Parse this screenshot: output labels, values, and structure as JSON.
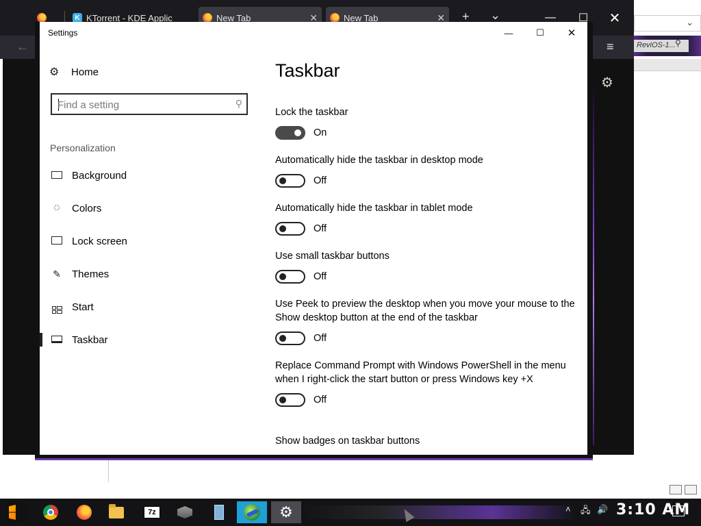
{
  "browser": {
    "tabs": [
      {
        "title": "",
        "favicon": "firefox-icon"
      },
      {
        "title": "KTorrent - KDE Applic",
        "favicon": "kde-icon"
      },
      {
        "title": "New Tab",
        "favicon": "firefox-icon"
      },
      {
        "title": "New Tab",
        "favicon": "firefox-icon"
      }
    ],
    "new_tab_glyph": "+",
    "list_tabs_glyph": "⌄",
    "window_buttons": {
      "minimize": "—",
      "maximize": "☐",
      "close": "✕"
    },
    "side_search_text": "ReviOS-1...",
    "accent_color": "#7a3ec7"
  },
  "settings": {
    "window_title": "Settings",
    "window_buttons": {
      "minimize": "—",
      "maximize": "☐",
      "close": "✕"
    },
    "nav": {
      "home_label": "Home",
      "search_placeholder": "Find a setting",
      "section_label": "Personalization",
      "items": [
        {
          "label": "Background",
          "icon": "picture-icon",
          "selected": false
        },
        {
          "label": "Colors",
          "icon": "palette-icon",
          "selected": false
        },
        {
          "label": "Lock screen",
          "icon": "lock-screen-icon",
          "selected": false
        },
        {
          "label": "Themes",
          "icon": "themes-icon",
          "selected": false
        },
        {
          "label": "Start",
          "icon": "start-icon",
          "selected": false
        },
        {
          "label": "Taskbar",
          "icon": "taskbar-icon",
          "selected": true
        }
      ]
    },
    "page": {
      "title": "Taskbar",
      "options": [
        {
          "label": "Lock the taskbar",
          "state": "On",
          "on": true
        },
        {
          "label": "Automatically hide the taskbar in desktop mode",
          "state": "Off",
          "on": false
        },
        {
          "label": "Automatically hide the taskbar in tablet mode",
          "state": "Off",
          "on": false
        },
        {
          "label": "Use small taskbar buttons",
          "state": "Off",
          "on": false
        },
        {
          "label": "Use Peek to preview the desktop when you move your mouse to the Show desktop button at the end of the taskbar",
          "state": "Off",
          "on": false
        },
        {
          "label": "Replace Command Prompt with Windows PowerShell in the menu when I right-click the start button or press Windows key +X",
          "state": "Off",
          "on": false
        },
        {
          "label": "Show badges on taskbar buttons",
          "state": "",
          "on": false
        }
      ]
    }
  },
  "taskbar": {
    "apps": [
      "start-icon",
      "chrome-icon",
      "firefox-icon",
      "file-explorer-icon",
      "7zip-icon",
      "package-icon",
      "document-icon",
      "network-globe-icon",
      "settings-gear-icon"
    ],
    "clock": "3:10 AM"
  }
}
